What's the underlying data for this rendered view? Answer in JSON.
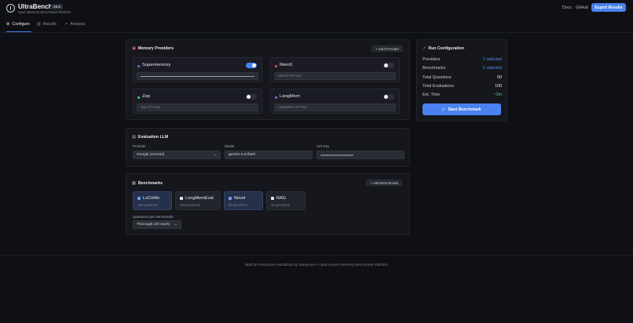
{
  "header": {
    "title": "UltraBench",
    "version": "v0.0",
    "subtitle": "Open Memory Benchmark Platform",
    "nav": [
      "Docs",
      "GitHub"
    ],
    "export_label": "Export Results"
  },
  "tabs": [
    {
      "label": "Configure",
      "icon": "gear-icon",
      "active": true
    },
    {
      "label": "Results",
      "icon": "bar-chart-icon",
      "active": false
    },
    {
      "label": "Analysis",
      "icon": "trend-icon",
      "active": false
    }
  ],
  "memory_providers": {
    "title": "Memory Providers",
    "add_label": "+ Add Provider",
    "providers": [
      {
        "name": "Supermemory",
        "dot_color": "#4a82ef",
        "enabled": true,
        "placeholder": ""
      },
      {
        "name": "Mem0",
        "dot_color": "#e65a4d",
        "enabled": false,
        "placeholder": "Mem0 API Key"
      },
      {
        "name": "Zep",
        "dot_color": "#3fcf8e",
        "enabled": false,
        "placeholder": "Zep API Key"
      },
      {
        "name": "LangMem",
        "dot_color": "#9a6bf0",
        "enabled": false,
        "placeholder": "LangMem API Key"
      }
    ]
  },
  "evaluation": {
    "title": "Evaluation LLM",
    "provider_label": "Provider",
    "provider_value": "Google (Gemini)",
    "model_label": "Model",
    "model_value": "gemini-2.5-flash",
    "api_key_label": "API Key",
    "api_key_value": "••••••••••••••••••••••••••••••••••••••"
  },
  "benchmarks": {
    "title": "Benchmarks",
    "add_label": "+ Add Benchmark",
    "items": [
      {
        "name": "LoCoMo",
        "sub": "150 questions",
        "selected": true
      },
      {
        "name": "LongMemEval",
        "sub": "500 questions",
        "selected": false
      },
      {
        "name": "Novel",
        "sub": "50 questions",
        "selected": true
      },
      {
        "name": "RAG",
        "sub": "30 questions",
        "selected": false
      }
    ],
    "questions_label": "Questions per benchmark",
    "questions_value": "Thorough (25 each)"
  },
  "run_config": {
    "title": "Run Configuration",
    "rows": [
      {
        "label": "Providers",
        "value": "1 selected",
        "style": "accent"
      },
      {
        "label": "Benchmarks",
        "value": "2 selected",
        "style": "accent"
      },
      {
        "label": "Total Questions",
        "value": "50",
        "style": "plain"
      },
      {
        "label": "Total Evaluations",
        "value": "100",
        "style": "plain"
      },
      {
        "label": "Est. Time",
        "value": "~3m",
        "style": "green"
      }
    ],
    "start_label": "Start Benchmark"
  },
  "footer": {
    "text": "Built for Devhouse Hackathon by Sanjeevan • Open-source Memory Benchmark Platform"
  }
}
